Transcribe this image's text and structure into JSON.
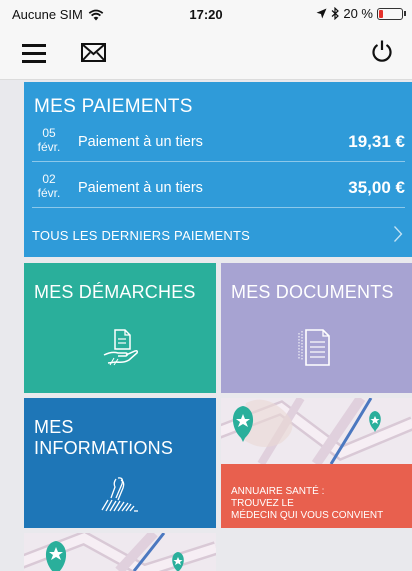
{
  "status_bar": {
    "carrier": "Aucune SIM",
    "time": "17:20",
    "battery": "20 %",
    "battery_level": 0.2
  },
  "header": {
    "menu_icon": "hamburger-menu-icon",
    "mail_icon": "envelope-icon",
    "power_icon": "power-icon"
  },
  "payments": {
    "title": "MES PAIEMENTS",
    "rows": [
      {
        "day": "05",
        "month": "févr.",
        "label": "Paiement à un tiers",
        "amount": "19,31 €"
      },
      {
        "day": "02",
        "month": "févr.",
        "label": "Paiement à un tiers",
        "amount": "35,00 €"
      }
    ],
    "all_label": "TOUS LES DERNIERS PAIEMENTS",
    "color": "#2f9bd9"
  },
  "tiles": {
    "demarches": {
      "title": "MES DÉMARCHES",
      "icon": "hand-document-icon",
      "color": "#2aaf9b"
    },
    "documents": {
      "title": "MES DOCUMENTS",
      "icon": "documents-icon",
      "color": "#a7a3d2"
    },
    "informations": {
      "title_line1": "MES",
      "title_line2": "INFORMATIONS",
      "icon": "fingerprint-icon",
      "color": "#1e76b7"
    },
    "annuaire": {
      "line1": "ANNUAIRE SANTÉ :",
      "line2": "TROUVEZ LE",
      "line3": "MÉDECIN QUI VOUS CONVIENT",
      "icon": "map-pins-icon",
      "color": "#e8604e"
    }
  }
}
